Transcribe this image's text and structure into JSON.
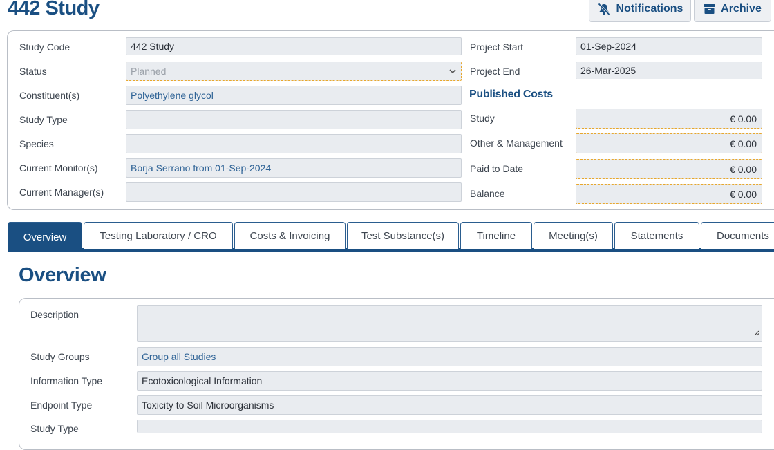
{
  "header": {
    "title": "442 Study",
    "notifications_label": "Notifications",
    "archive_label": "Archive"
  },
  "study": {
    "labels": {
      "study_code": "Study Code",
      "status": "Status",
      "constituents": "Constituent(s)",
      "study_type": "Study Type",
      "species": "Species",
      "current_monitors": "Current Monitor(s)",
      "current_managers": "Current Manager(s)",
      "project_start": "Project Start",
      "project_end": "Project End"
    },
    "values": {
      "study_code": "442 Study",
      "status": "Planned",
      "constituents": "Polyethylene glycol",
      "study_type": "",
      "species": "",
      "current_monitors": "Borja Serrano from 01-Sep-2024",
      "current_managers": "",
      "project_start": "01-Sep-2024",
      "project_end": "26-Mar-2025"
    }
  },
  "costs": {
    "heading": "Published Costs",
    "rows": [
      {
        "label": "Study",
        "value": "€ 0.00"
      },
      {
        "label": "Other & Management",
        "value": "€ 0.00"
      },
      {
        "label": "Paid to Date",
        "value": "€ 0.00"
      },
      {
        "label": "Balance",
        "value": "€ 0.00"
      }
    ]
  },
  "tabs": [
    {
      "label": "Overview",
      "active": true
    },
    {
      "label": "Testing Laboratory / CRO"
    },
    {
      "label": "Costs & Invoicing"
    },
    {
      "label": "Test Substance(s)"
    },
    {
      "label": "Timeline"
    },
    {
      "label": "Meeting(s)"
    },
    {
      "label": "Statements"
    },
    {
      "label": "Documents"
    }
  ],
  "overview": {
    "title": "Overview",
    "labels": {
      "description": "Description",
      "study_groups": "Study Groups",
      "information_type": "Information Type",
      "endpoint_type": "Endpoint Type",
      "study_type": "Study Type"
    },
    "values": {
      "description": "",
      "study_groups": "Group all Studies",
      "information_type": "Ecotoxicological Information",
      "endpoint_type": "Toxicity to Soil Microorganisms",
      "study_type": ""
    }
  },
  "colors": {
    "brand": "#1a4f82",
    "link_text": "#2f6396",
    "warning_border": "#e8a72c",
    "field_bg": "#e9ecf0"
  },
  "icons": {
    "notifications": "bell-slash-icon",
    "archive": "archive-box-icon",
    "status_dropdown": "chevron-down-icon",
    "resize": "resize-handle-icon"
  }
}
